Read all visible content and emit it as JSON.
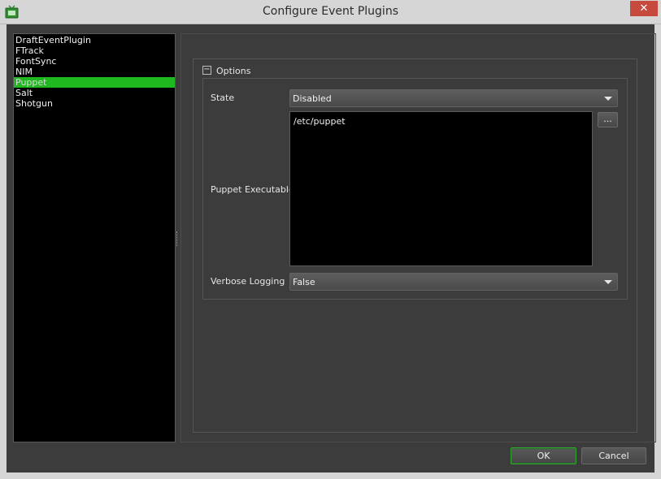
{
  "window": {
    "title": "Configure Event Plugins",
    "close_glyph": "✕",
    "icon": "deadline-monitor-icon"
  },
  "plugins": {
    "items": [
      "DraftEventPlugin",
      "FTrack",
      "FontSync",
      "NIM",
      "Puppet",
      "Salt",
      "Shotgun"
    ],
    "selected": "Puppet"
  },
  "options": {
    "group_label": "Options",
    "toggle_glyph": "−",
    "state_label": "State",
    "state_value": "Disabled",
    "executable_label": "Puppet Executable",
    "executable_value": "/etc/puppet",
    "browse_label": "...",
    "verbose_label": "Verbose Logging",
    "verbose_value": "False"
  },
  "buttons": {
    "ok_label": "OK",
    "cancel_label": "Cancel"
  },
  "colors": {
    "selection": "#1fb81f",
    "close_button": "#c74a3f",
    "background": "#3c3c3c"
  }
}
